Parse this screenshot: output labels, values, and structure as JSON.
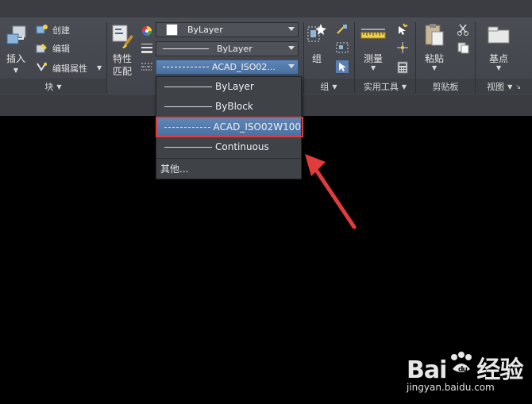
{
  "ribbon": {
    "block": {
      "insert_label": "插入",
      "create_label": "创建",
      "edit_label": "编辑",
      "edit_attr_label": "编辑属性",
      "panel_title": "块"
    },
    "properties": {
      "match_label_line1": "特性",
      "match_label_line2": "匹配",
      "color_value": "ByLayer",
      "lineweight_value": "ByLayer",
      "linetype_value": "ACAD_ISO02..."
    },
    "group": {
      "group_label": "组",
      "panel_title": "组"
    },
    "utilities": {
      "measure_label": "测量",
      "panel_title": "实用工具"
    },
    "clipboard": {
      "paste_label": "粘贴",
      "panel_title": "剪贴板"
    },
    "view": {
      "basepoint_label": "基点",
      "panel_title": "视图"
    }
  },
  "linetype_dropdown": {
    "options": [
      {
        "label": "ByLayer",
        "style": "solid"
      },
      {
        "label": "ByBlock",
        "style": "solid"
      },
      {
        "label": "ACAD_ISO02W100",
        "style": "dashed",
        "selected": true
      },
      {
        "label": "Continuous",
        "style": "solid"
      }
    ],
    "other_label": "其他..."
  },
  "watermark": {
    "brand": "Bai",
    "brand_suffix": "经验",
    "url": "jingyan.baidu.com"
  },
  "colors": {
    "accent_highlight": "#e23b3b",
    "selection": "#5a7fb0"
  }
}
